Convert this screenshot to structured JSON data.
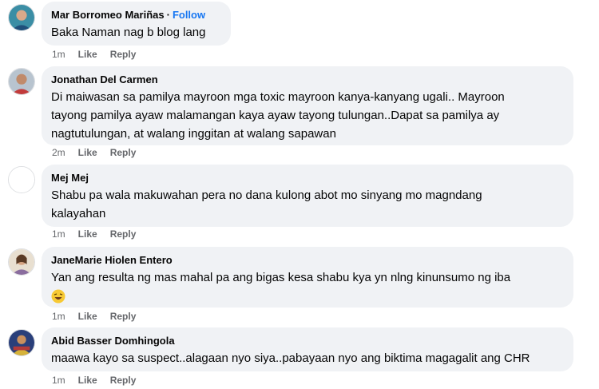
{
  "comments": [
    {
      "author": "Mar Borromeo Mariñas",
      "dot": "·",
      "follow_label": "Follow",
      "text": "Baka Naman nag b blog lang",
      "time": "1m",
      "like_label": "Like",
      "reply_label": "Reply"
    },
    {
      "author": "Jonathan Del Carmen",
      "text_lines": [
        "Di maiwasan sa pamilya mayroon mga toxic mayroon kanya-kanyang ugali.. Mayroon",
        "tayong pamilya ayaw malamangan kaya ayaw tayong tulungan..Dapat sa pamilya ay",
        "nagtutulungan, at walang inggitan at walang sapawan"
      ],
      "time": "2m",
      "like_label": "Like",
      "reply_label": "Reply"
    },
    {
      "author": "Mej Mej",
      "text_lines": [
        "Shabu pa wala makuwahan pera no dana kulong abot mo sinyang mo magndang",
        "kalayahan"
      ],
      "time": "1m",
      "like_label": "Like",
      "reply_label": "Reply"
    },
    {
      "author": "JaneMarie Hiolen Entero",
      "text": "Yan ang resulta ng mas mahal pa ang bigas kesa shabu kya yn nlng kinunsumo ng iba",
      "emoji": "laughing-emoji",
      "time": "1m",
      "like_label": "Like",
      "reply_label": "Reply"
    },
    {
      "author": "Abid Basser Domhingola",
      "text": "maawa kayo sa suspect..alagaan nyo siya..pabayaan nyo ang biktima magagalit ang CHR",
      "time": "1m",
      "like_label": "Like",
      "reply_label": "Reply"
    }
  ],
  "colors": {
    "bubble": "#f0f2f5",
    "follow": "#1877f2",
    "meta": "#65676b"
  }
}
